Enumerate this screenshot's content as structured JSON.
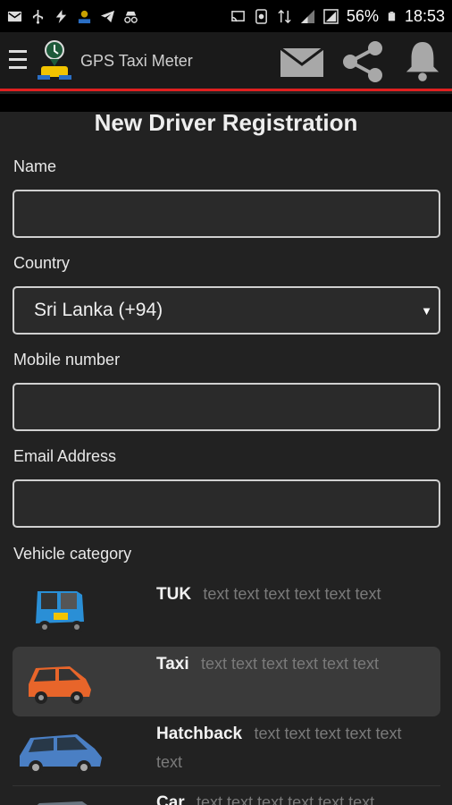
{
  "status_bar": {
    "battery_percent": "56%",
    "time": "18:53"
  },
  "app_bar": {
    "title": "GPS Taxi Meter",
    "icons": [
      "menu-icon",
      "app-logo",
      "mail-icon",
      "share-icon",
      "bell-icon"
    ]
  },
  "form": {
    "title": "New Driver Registration",
    "name_label": "Name",
    "name_value": "",
    "country_label": "Country",
    "country_value": "Sri Lanka (+94)",
    "mobile_label": "Mobile number",
    "mobile_value": "",
    "email_label": "Email Address",
    "email_value": "",
    "vehicle_label": "Vehicle category"
  },
  "vehicles": [
    {
      "name": "TUK",
      "desc": "text text text text text text",
      "selected": false
    },
    {
      "name": "Taxi",
      "desc": "text text text text text text",
      "selected": true
    },
    {
      "name": "Hatchback",
      "desc": "text text text text text text",
      "selected": false
    },
    {
      "name": "Car",
      "desc": "text text text text text text",
      "selected": false
    }
  ],
  "colors": {
    "accent_red": "#e02020",
    "background": "#222222",
    "tuk_blue": "#2a8fd6",
    "taxi_orange": "#e8652a",
    "hatch_blue": "#4a7fc4"
  }
}
